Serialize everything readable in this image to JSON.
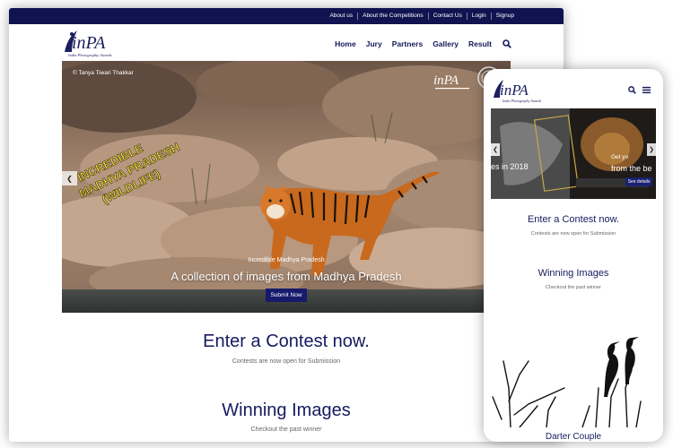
{
  "desktop": {
    "topbar_links": [
      "About us",
      "About the Competitions",
      "Contact Us",
      "Login",
      "Signup"
    ],
    "logo": {
      "text": "inPA",
      "tagline": "India Photography Awards"
    },
    "nav": [
      "Home",
      "Jury",
      "Partners",
      "Gallery",
      "Result"
    ],
    "search_icon": "search-icon",
    "hero": {
      "credit": "© Tanya Tiwari Thakkar",
      "overlay_art_text": "Incredible Madhya Pradesh (Wildlife)",
      "subtitle": "Incredible Madhya Pradesh",
      "title": "A collection of images from Madhya Pradesh",
      "button": "Submit Now",
      "prev_icon": "chevron-left-icon"
    },
    "sections": [
      {
        "title": "Enter a Contest now.",
        "subtitle": "Contests are now open for Submission"
      },
      {
        "title": "Winning Images",
        "subtitle": "Checkout the past winner"
      }
    ]
  },
  "mobile": {
    "logo": {
      "text": "inPA",
      "tagline": "India Photography Awards"
    },
    "icons": [
      "search-icon",
      "menu-icon"
    ],
    "slider": {
      "left_text": "es in 2018",
      "right_text_1": "Get yo",
      "right_text_2": "from the be",
      "button": "See details"
    },
    "sections": [
      {
        "title": "Enter a Contest now.",
        "subtitle": "Contests are now open for Submission"
      },
      {
        "title": "Winning Images",
        "subtitle": "Checkout the past winner"
      }
    ],
    "caption": "Darter Couple"
  }
}
